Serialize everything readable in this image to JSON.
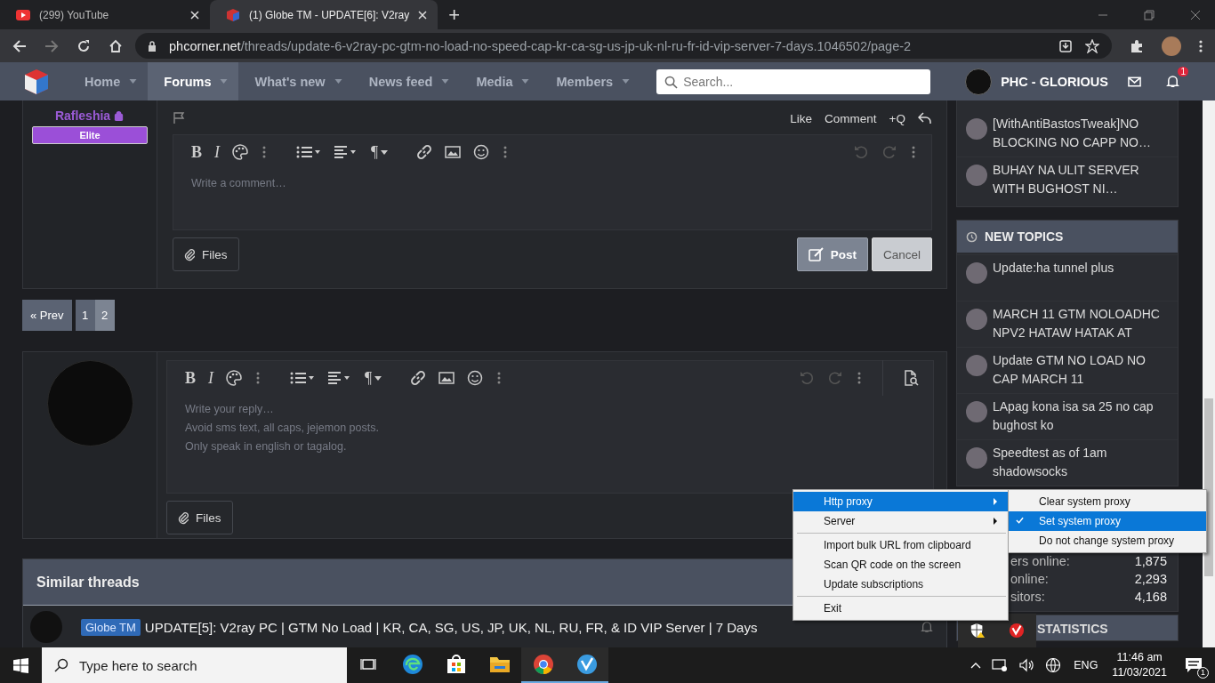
{
  "browser": {
    "tabs": [
      {
        "title": "(299) YouTube",
        "selected": false
      },
      {
        "title": "(1) Globe TM - UPDATE[6]: V2ray",
        "selected": true
      }
    ],
    "new_tab": "+",
    "url": {
      "host": "phcorner.net",
      "path": "/threads/update-6-v2ray-pc-gtm-no-load-no-speed-cap-kr-ca-sg-us-jp-uk-nl-ru-fr-id-vip-server-7-days.1046502/page-2"
    }
  },
  "nav": {
    "items": [
      {
        "label": "Home",
        "selected": false
      },
      {
        "label": "Forums",
        "selected": true
      },
      {
        "label": "What's new",
        "selected": false
      },
      {
        "label": "News feed",
        "selected": false
      },
      {
        "label": "Media",
        "selected": false
      },
      {
        "label": "Members",
        "selected": false
      }
    ],
    "search": {
      "placeholder": "Search..."
    },
    "user": "PHC - GLORIOUS",
    "alerts_badge": "1"
  },
  "post": {
    "author": "Rafleshia",
    "rank": "Elite",
    "actions": [
      "Like",
      "Comment",
      "+Q"
    ],
    "editor": {
      "bold": "B",
      "italic": "I",
      "paragraph": "¶",
      "placeholder": "Write a comment…"
    },
    "files_button": "Files",
    "post_button": "Post",
    "cancel_button": "Cancel"
  },
  "pagination": {
    "prev": "« Prev",
    "pages": [
      {
        "label": "1",
        "selected": false
      },
      {
        "label": "2",
        "selected": true
      }
    ]
  },
  "reply": {
    "editor": {
      "bold": "B",
      "italic": "I",
      "paragraph": "¶",
      "placeholder": "Write your reply…\nAvoid sms text, all caps, jejemon posts.\nOnly speak in english or tagalog."
    },
    "files_button": "Files"
  },
  "similar_threads": {
    "title": "Similar threads",
    "rows": [
      {
        "tag": "Globe TM",
        "title": "UPDATE[5]: V2ray PC | GTM No Load | KR, CA, SG, US, JP, UK, NL, RU, FR, & ID VIP Server | 7 Days"
      }
    ]
  },
  "sidebar": {
    "threads": [
      "[WithAntiBastosTweak]NO BLOCKING NO CAPP NO…",
      "BUHAY NA ULIT SERVER WITH BUGHOST NI…"
    ],
    "new_topics": {
      "title": "NEW TOPICS",
      "items": [
        "Update:ha tunnel plus",
        "MARCH 11 GTM NOLOADHC NPV2 HATAW HATAK AT",
        "Update GTM NO LOAD NO CAP MARCH 11",
        "LApag kona isa sa 25 no cap bughost ko",
        "Speedtest as of 1am shadowsocks"
      ]
    },
    "stats": [
      {
        "label": "ers online:",
        "value": "1,875"
      },
      {
        "label": "online:",
        "value": "2,293"
      },
      {
        "label": "sitors:",
        "value": "4,168"
      }
    ],
    "statistics_title": "STATISTICS"
  },
  "context_menu": {
    "items": [
      {
        "kind": "item",
        "label": "Http proxy",
        "submenu": true,
        "selected": true
      },
      {
        "kind": "item",
        "label": "Server",
        "submenu": true,
        "selected": false
      },
      {
        "kind": "separator"
      },
      {
        "kind": "item",
        "label": "Import bulk URL from clipboard",
        "submenu": false,
        "selected": false
      },
      {
        "kind": "item",
        "label": "Scan QR code on the screen",
        "submenu": false,
        "selected": false
      },
      {
        "kind": "item",
        "label": "Update subscriptions",
        "submenu": false,
        "selected": false
      },
      {
        "kind": "separator"
      },
      {
        "kind": "item",
        "label": "Exit",
        "submenu": false,
        "selected": false
      }
    ],
    "submenu": [
      {
        "label": "Clear system proxy",
        "checked": false,
        "selected": false
      },
      {
        "label": "Set system proxy",
        "checked": true,
        "selected": true
      },
      {
        "label": "Do not change system proxy",
        "checked": false,
        "selected": false
      }
    ]
  },
  "taskbar": {
    "search": {
      "placeholder": "Type here to search"
    },
    "apps": [
      {
        "kind": "task-view",
        "running": false
      },
      {
        "kind": "edge",
        "running": false
      },
      {
        "kind": "store",
        "running": false
      },
      {
        "kind": "folder",
        "running": false
      },
      {
        "kind": "chrome",
        "running": true
      },
      {
        "kind": "v2ray",
        "running": true
      }
    ],
    "language": "ENG",
    "time": "11:46 am",
    "date": "11/03/2021",
    "notifications_badge": "1"
  }
}
